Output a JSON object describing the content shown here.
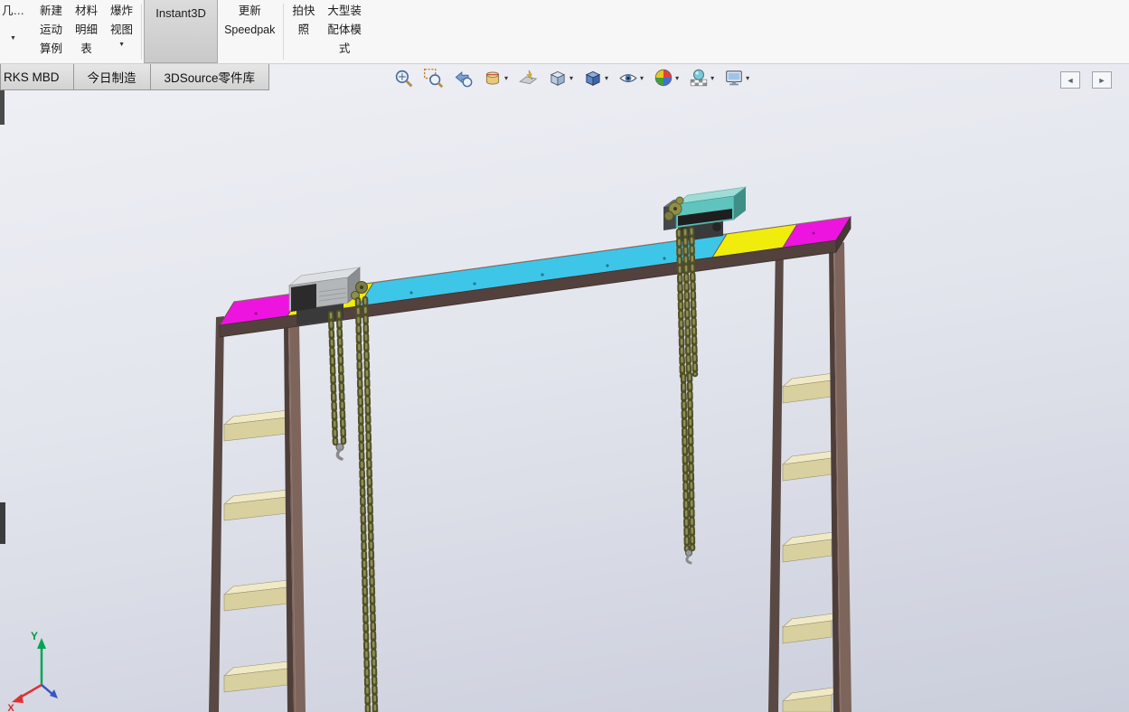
{
  "ui": {
    "caret": "▼",
    "caret_small": "▾",
    "pane_left": "◄",
    "pane_right": "►"
  },
  "toolbar": {
    "items": [
      {
        "line1": "几…",
        "caret": "▼"
      },
      {
        "line1": "新建",
        "line2": "运动",
        "line3": "算例"
      },
      {
        "line1": "材料",
        "line2": "明细",
        "line3": "表"
      },
      {
        "line1": "爆炸",
        "line2": "视图",
        "caret": "▼"
      },
      {
        "line1": "Instant3D"
      },
      {
        "line1": "更新",
        "line2": "Speedpak"
      },
      {
        "line1": "拍快",
        "line2": "照"
      },
      {
        "line1": "大型装",
        "line2": "配体模",
        "line3": "式"
      }
    ]
  },
  "tabs": [
    {
      "label": "RKS MBD"
    },
    {
      "label": "今日制造"
    },
    {
      "label": "3DSource零件库"
    }
  ],
  "view_toolbar": {
    "icons": [
      "zoom-to-fit",
      "zoom-to-area",
      "previous-view",
      "section-view",
      "dynamic-annotation-views",
      "view-orientation",
      "display-style",
      "hide-show-items",
      "edit-appearance",
      "apply-scene",
      "view-settings"
    ]
  },
  "viewport": {
    "triad": {
      "y_label": "Y",
      "x_label": "X"
    },
    "model": {
      "kind": "gantry-hoist-assembly",
      "colors": {
        "deck_cyan": "#3ec6e8",
        "plate_yellow": "#f0ed0c",
        "plate_magenta": "#ee14e0",
        "frame_brown": "#7d655c",
        "rung_tan": "#ddd5a4",
        "chain_olive": "#4f4f28",
        "hoist_left_gray": "#b4b7ba",
        "hoist_right_teal": "#5fc4bd"
      }
    }
  }
}
